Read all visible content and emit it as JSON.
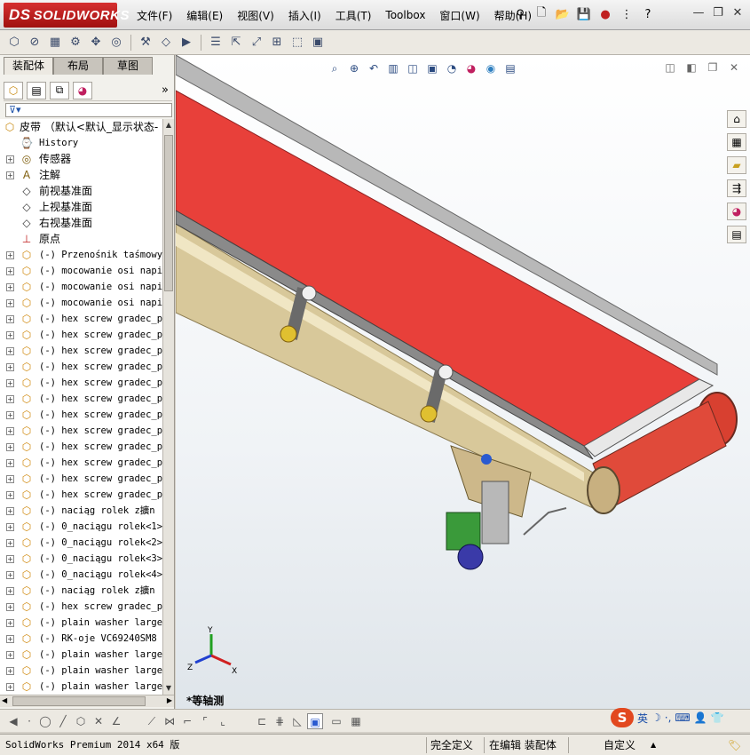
{
  "app": {
    "logo_text": "SOLIDWORKS",
    "logo_prefix": "DS"
  },
  "menu": [
    "文件(F)",
    "编辑(E)",
    "视图(V)",
    "插入(I)",
    "工具(T)",
    "Toolbox",
    "窗口(W)",
    "帮助(H)"
  ],
  "panel": {
    "tabs": [
      "装配体",
      "布局",
      "草图"
    ],
    "more_glyph": "»"
  },
  "tree": {
    "root": "皮带 （默认<默认_显示状态-",
    "items": [
      {
        "icon": "history-icon",
        "label": "History",
        "mono": true
      },
      {
        "icon": "sensor-icon",
        "label": "传感器"
      },
      {
        "icon": "annotation-icon",
        "label": "注解"
      },
      {
        "icon": "plane-icon",
        "label": "前视基准面"
      },
      {
        "icon": "plane-icon",
        "label": "上视基准面"
      },
      {
        "icon": "plane-icon",
        "label": "右视基准面"
      },
      {
        "icon": "origin-icon",
        "label": "原点"
      },
      {
        "icon": "part-icon",
        "label": "(-) Przenośnik taśmowy"
      },
      {
        "icon": "part-icon",
        "label": "(-) mocowanie osi napin"
      },
      {
        "icon": "part-icon",
        "label": "(-) mocowanie osi napin"
      },
      {
        "icon": "part-icon",
        "label": "(-) mocowanie osi napin"
      },
      {
        "icon": "part-icon",
        "label": "(-) hex screw gradec_pe"
      },
      {
        "icon": "part-icon",
        "label": "(-) hex screw gradec_pe"
      },
      {
        "icon": "part-icon",
        "label": "(-) hex screw gradec_pe"
      },
      {
        "icon": "part-icon",
        "label": "(-) hex screw gradec_pe"
      },
      {
        "icon": "part-icon",
        "label": "(-) hex screw gradec_pe"
      },
      {
        "icon": "part-icon",
        "label": "(-) hex screw gradec_pe"
      },
      {
        "icon": "part-icon",
        "label": "(-) hex screw gradec_pe"
      },
      {
        "icon": "part-icon",
        "label": "(-) hex screw gradec_pe"
      },
      {
        "icon": "part-icon",
        "label": "(-) hex screw gradec_pe"
      },
      {
        "icon": "part-icon",
        "label": "(-) hex screw gradec_pe"
      },
      {
        "icon": "part-icon",
        "label": "(-) hex screw gradec_pe"
      },
      {
        "icon": "part-icon",
        "label": "(-) hex screw gradec_pe"
      },
      {
        "icon": "part-icon",
        "label": "(-) naciąg rolek z擴n"
      },
      {
        "icon": "part-icon",
        "label": "(-) 0_naciągu rolek<1>"
      },
      {
        "icon": "part-icon",
        "label": "(-) 0_naciągu rolek<2>"
      },
      {
        "icon": "part-icon",
        "label": "(-) 0_naciągu rolek<3>"
      },
      {
        "icon": "part-icon",
        "label": "(-) 0_naciągu rolek<4>"
      },
      {
        "icon": "part-icon",
        "label": "(-) naciąg rolek z擴n"
      },
      {
        "icon": "part-icon",
        "label": "(-) hex screw gradec_pe"
      },
      {
        "icon": "part-icon",
        "label": "(-) plain washer large"
      },
      {
        "icon": "part-icon",
        "label": "(-) RK-oje VC69240SM8"
      },
      {
        "icon": "part-icon",
        "label": "(-) plain washer large"
      },
      {
        "icon": "part-icon",
        "label": "(-) plain washer large"
      },
      {
        "icon": "part-icon",
        "label": "(-) plain washer large"
      }
    ]
  },
  "viewport": {
    "view_name": "*等轴测",
    "axes": {
      "x": "X",
      "y": "Y",
      "z": "Z"
    }
  },
  "ime": {
    "mode": "英"
  },
  "status": {
    "app_version": "SolidWorks Premium 2014 x64 版",
    "definition": "完全定义",
    "edit_mode": "在编辑 装配体",
    "custom": "自定义"
  },
  "colors": {
    "belt": "#e8403a",
    "frame": "#d8c89a",
    "logo": "#c02020"
  }
}
